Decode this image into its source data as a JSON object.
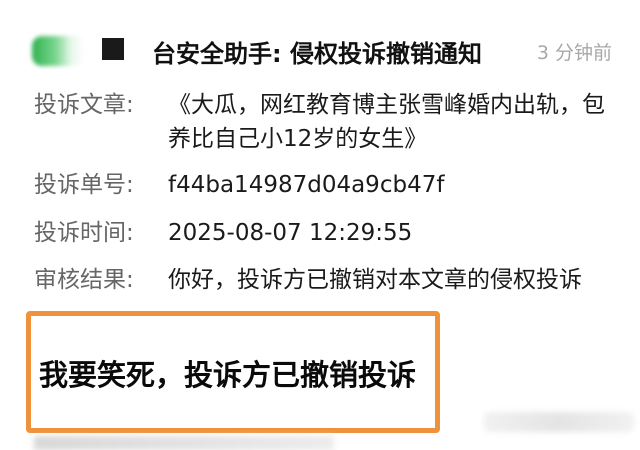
{
  "notification": {
    "sender_title": "台安全助手: 侵权投诉撤销通知",
    "time_ago": "3 分钟前"
  },
  "details": [
    {
      "label": "投诉文章:",
      "value": "《大瓜，网红教育博主张雪峰婚内出轨，包养比自己小12岁的女生》"
    },
    {
      "label": "投诉单号:",
      "value": "f44ba14987d04a9cb47f"
    },
    {
      "label": "投诉时间:",
      "value": "2025-08-07 12:29:55"
    },
    {
      "label": "审核结果:",
      "value": "你好，投诉方已撤销对本文章的侵权投诉"
    }
  ],
  "highlight": {
    "text": "我要笑死，投诉方已撤销投诉",
    "border_color": "#f0913c"
  },
  "colors": {
    "label": "#666666",
    "value": "#1a1a1a",
    "time": "#a8a8a8",
    "avatar_green": "#2fb24f"
  }
}
